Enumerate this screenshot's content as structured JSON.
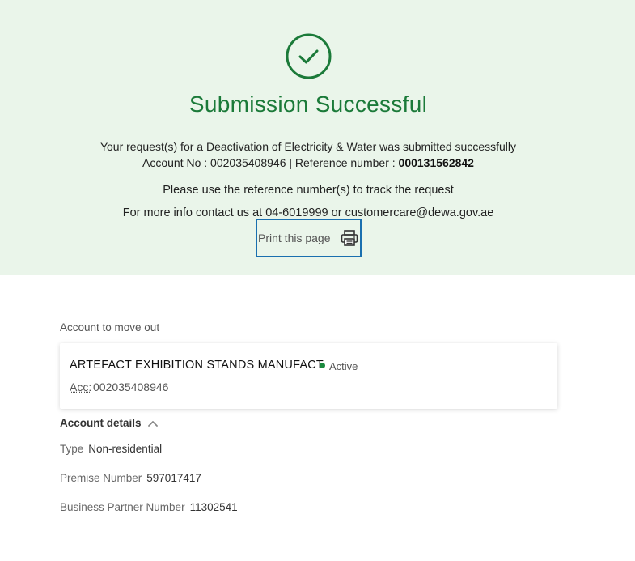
{
  "banner": {
    "title": "Submission Successful",
    "message_line": "Your request(s) for a Deactivation of Electricity & Water was submitted successfully",
    "account_prefix": "Account No : 002035408946 | Reference number : ",
    "reference_number": "000131562842",
    "track_text": "Please use the reference number(s) to track the request",
    "contact_text": "For more info contact us at 04-6019999 or customercare@dewa.gov.ae",
    "print_label": "Print this page",
    "icons": {
      "success": "check-circle-icon",
      "print": "printer-icon"
    },
    "colors": {
      "banner_bg": "#eaf5ea",
      "accent": "#1b7a39",
      "focus_border": "#1a6faf"
    }
  },
  "account_section": {
    "label": "Account to move out",
    "card": {
      "name": "ARTEFACT EXHIBITION STANDS MANUFACT",
      "status": "Active",
      "status_color": "#1b8a3f",
      "acc_prefix": "Acc:",
      "acc_number": "002035408946"
    }
  },
  "details": {
    "title": "Account details",
    "toggle_icon": "chevron-up-icon",
    "rows": [
      {
        "label": "Type",
        "value": "Non-residential"
      },
      {
        "label": "Premise Number",
        "value": "597017417"
      },
      {
        "label": "Business Partner Number",
        "value": "11302541"
      }
    ]
  }
}
